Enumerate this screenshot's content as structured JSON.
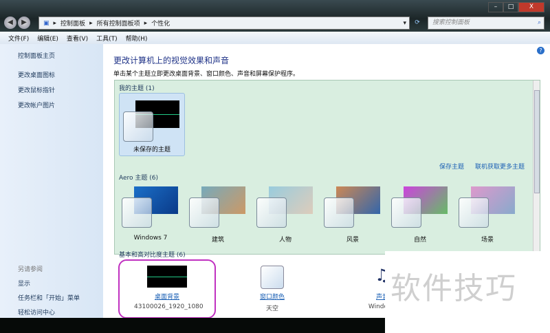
{
  "window": {
    "min": "–",
    "max": "□",
    "close": "X"
  },
  "address": {
    "crumbs": [
      "控制面板",
      "所有控制面板项",
      "个性化"
    ],
    "search_placeholder": "搜索控制面板"
  },
  "menu": [
    "文件(F)",
    "编辑(E)",
    "查看(V)",
    "工具(T)",
    "帮助(H)"
  ],
  "sidebar": {
    "home": "控制面板主页",
    "items": [
      "更改桌面图标",
      "更改鼠标指针",
      "更改帐户图片"
    ],
    "see_also": "另请参阅",
    "see_items": [
      "显示",
      "任务栏和「开始」菜单",
      "轻松访问中心"
    ]
  },
  "main": {
    "title": "更改计算机上的视觉效果和声音",
    "subtitle": "单击某个主题立即更改桌面背景、窗口颜色、声音和屏幕保护程序。",
    "my_themes": "我的主题 (1)",
    "unsaved": "未保存的主题",
    "save_theme": "保存主题",
    "get_more": "联机获取更多主题",
    "aero": "Aero 主题 (6)",
    "aero_items": [
      "Windows 7",
      "建筑",
      "人物",
      "风景",
      "自然",
      "场景"
    ],
    "basic": "基本和高对比度主题 (6)"
  },
  "bottom": [
    {
      "label": "桌面背景",
      "value": "43100026_1920_1080"
    },
    {
      "label": "窗口颜色",
      "value": "天空"
    },
    {
      "label": "声音",
      "value": "Windows"
    }
  ],
  "watermark": "软件技巧",
  "colors": {
    "panel": "#d9eee0",
    "link": "#1a5fb4",
    "highlight": "#c030c0"
  }
}
